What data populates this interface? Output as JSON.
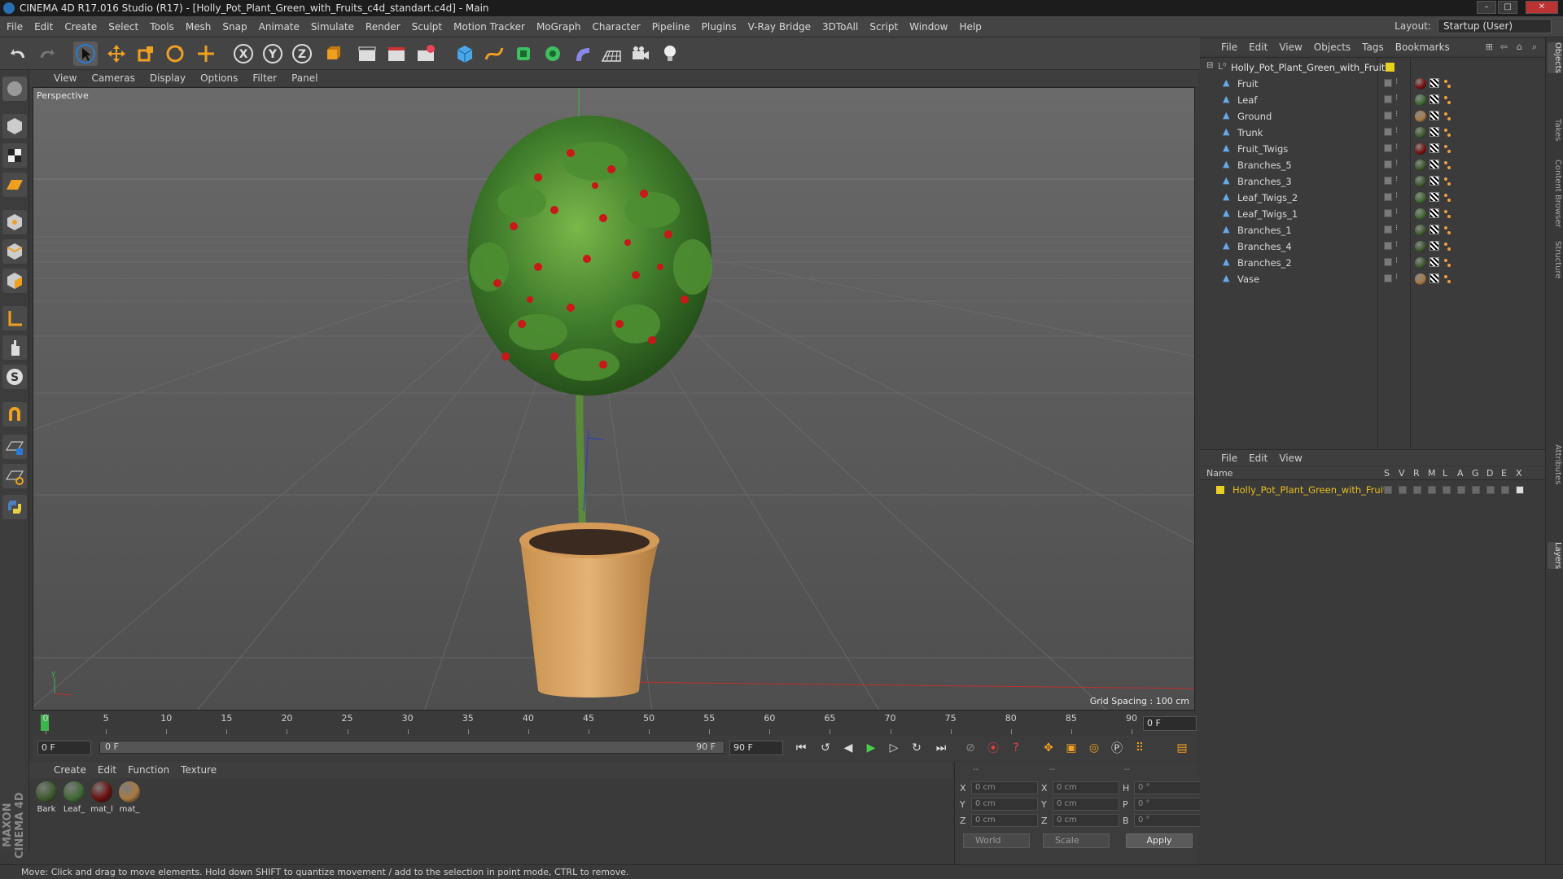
{
  "window": {
    "title": "CINEMA 4D R17.016 Studio (R17) - [Holly_Pot_Plant_Green_with_Fruits_c4d_standart.c4d] - Main",
    "minimize": "–",
    "maximize": "□",
    "close": "✕"
  },
  "menu": [
    "File",
    "Edit",
    "Create",
    "Select",
    "Tools",
    "Mesh",
    "Snap",
    "Animate",
    "Simulate",
    "Render",
    "Sculpt",
    "Motion Tracker",
    "MoGraph",
    "Character",
    "Pipeline",
    "Plugins",
    "V-Ray Bridge",
    "3DToAll",
    "Script",
    "Window",
    "Help"
  ],
  "layout": {
    "label": "Layout:",
    "value": "Startup (User)"
  },
  "viewport": {
    "menu": [
      "View",
      "Cameras",
      "Display",
      "Options",
      "Filter",
      "Panel"
    ],
    "label": "Perspective",
    "grid_spacing": "Grid Spacing : 100 cm"
  },
  "timeline": {
    "ticks": [
      "0",
      "5",
      "10",
      "15",
      "20",
      "25",
      "30",
      "35",
      "40",
      "45",
      "50",
      "55",
      "60",
      "65",
      "70",
      "75",
      "80",
      "85",
      "90"
    ],
    "current_frame": "0 F",
    "start_field": "0 F",
    "range_start": "0 F",
    "range_end": "90 F",
    "end_field": "90 F"
  },
  "materials": {
    "menu": [
      "Create",
      "Edit",
      "Function",
      "Texture"
    ],
    "items": [
      {
        "label": "Bark",
        "color": "#3e5a2e"
      },
      {
        "label": "Leaf_",
        "color": "#3f6a34"
      },
      {
        "label": "mat_l",
        "color": "#6a1010"
      },
      {
        "label": "mat_",
        "color": "#a87a44"
      }
    ]
  },
  "coords": {
    "rows": [
      {
        "a": "X",
        "av": "0 cm",
        "b": "X",
        "bv": "0 cm",
        "c": "H",
        "cv": "0 °"
      },
      {
        "a": "Y",
        "av": "0 cm",
        "b": "Y",
        "bv": "0 cm",
        "c": "P",
        "cv": "0 °"
      },
      {
        "a": "Z",
        "av": "0 cm",
        "b": "Z",
        "bv": "0 cm",
        "c": "B",
        "cv": "0 °"
      }
    ],
    "headers": [
      "--",
      "--",
      "--"
    ],
    "world": "World",
    "scale": "Scale",
    "apply": "Apply"
  },
  "status": "Move: Click and drag to move elements. Hold down SHIFT to quantize movement / add to the selection in point mode, CTRL to remove.",
  "objects": {
    "menu": [
      "File",
      "Edit",
      "View",
      "Objects",
      "Tags",
      "Bookmarks"
    ],
    "root": "Holly_Pot_Plant_Green_with_Fruits",
    "children": [
      {
        "name": "Fruit",
        "mat": "#7a1010"
      },
      {
        "name": "Leaf",
        "mat": "#3f6a34"
      },
      {
        "name": "Ground",
        "mat": "#a87a44"
      },
      {
        "name": "Trunk",
        "mat": "#3e5a2e"
      },
      {
        "name": "Fruit_Twigs",
        "mat": "#7a1010"
      },
      {
        "name": "Branches_5",
        "mat": "#3e5a2e"
      },
      {
        "name": "Branches_3",
        "mat": "#3e5a2e"
      },
      {
        "name": "Leaf_Twigs_2",
        "mat": "#3f6a34"
      },
      {
        "name": "Leaf_Twigs_1",
        "mat": "#3f6a34"
      },
      {
        "name": "Branches_1",
        "mat": "#3e5a2e"
      },
      {
        "name": "Branches_4",
        "mat": "#3e5a2e"
      },
      {
        "name": "Branches_2",
        "mat": "#3e5a2e"
      },
      {
        "name": "Vase",
        "mat": "#a87a44"
      }
    ]
  },
  "layers": {
    "menu": [
      "File",
      "Edit",
      "View"
    ],
    "columns": [
      "Name",
      "S",
      "V",
      "R",
      "M",
      "L",
      "A",
      "G",
      "D",
      "E",
      "X"
    ],
    "items": [
      "Holly_Pot_Plant_Green_with_Fruits"
    ]
  },
  "right_tabs": [
    "Objects",
    "Takes",
    "Content Browser",
    "Structure",
    "Attributes",
    "Layers"
  ]
}
